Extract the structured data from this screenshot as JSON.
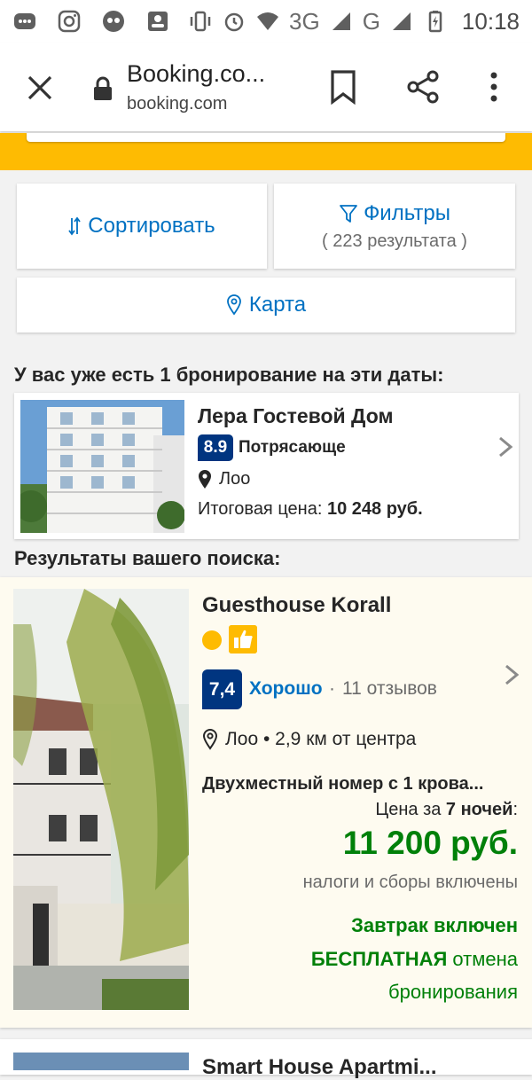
{
  "status_bar": {
    "network_3g": "3G",
    "network_g": "G",
    "time": "10:18"
  },
  "browser": {
    "page_title": "Booking.co...",
    "host": "booking.com",
    "icons": [
      "close-icon",
      "lock-icon",
      "bookmark-icon",
      "share-icon",
      "more-vert-icon"
    ]
  },
  "toolbar": {
    "sort_label": "Сортировать",
    "filter_label": "Фильтры",
    "filter_count": "( 223 результата )",
    "map_label": "Карта"
  },
  "existing_booking": {
    "heading": "У вас уже есть 1 бронирование на эти даты:",
    "hotel_name": "Лера Гостевой Дом",
    "score": "8.9",
    "score_word": "Потрясающе",
    "location": "Лоо",
    "price_label": "Итоговая цена:",
    "price": "10 248 руб."
  },
  "results": {
    "heading": "Результаты вашего поиска:",
    "items": [
      {
        "name": "Guesthouse Korall",
        "score": "7,4",
        "score_word": "Хорошо",
        "separator": "·",
        "reviews": "11 отзывов",
        "location": "Лоо • 2,9 км от центра",
        "room_type": "Двухместный номер с 1 крова...",
        "price_label_prefix": "Цена за",
        "nights": "7 ночей",
        "price_label_suffix": ":",
        "price": "11 200 руб.",
        "taxes": "налоги и сборы включены",
        "breakfast": "Завтрак включен",
        "cancel_free": "БЕСПЛАТНАЯ",
        "cancel_rest": " отмена",
        "cancel_line2": "бронирования"
      },
      {
        "name": "Smart House Apartmi..."
      }
    ]
  },
  "colors": {
    "brand_yellow": "#febb02",
    "brand_blue": "#003580",
    "link_blue": "#0071c2",
    "price_green": "#008009"
  }
}
